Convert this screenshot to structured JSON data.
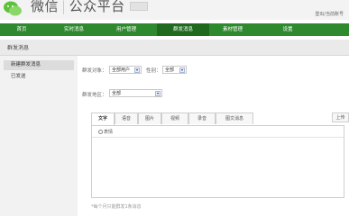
{
  "header": {
    "logo_text_a": "微信",
    "logo_text_b": "公众平台",
    "tag": "",
    "right_link": "登出/当前账号"
  },
  "nav": {
    "items": [
      "首页",
      "实时消息",
      "用户管理",
      "群发消息",
      "素材管理",
      "设置"
    ],
    "active_index": 3
  },
  "section": {
    "title": "群发消息"
  },
  "sidebar": {
    "items": [
      {
        "label": "新建群发消息",
        "active": true
      },
      {
        "label": "已发送",
        "active": false
      }
    ]
  },
  "form": {
    "target_label": "群发对象：",
    "target_value": "全部用户",
    "gender_label": "性别：",
    "gender_value": "全部",
    "region_label": "群发地区：",
    "region_value": "全部"
  },
  "tabs": {
    "items": [
      "文字",
      "语音",
      "图片",
      "视频",
      "录音",
      "图文消息"
    ],
    "active_index": 0
  },
  "upload": {
    "label": "上传"
  },
  "editor": {
    "emoji_label": "表情"
  },
  "note": "*每个月只能群发1条消息",
  "colors": {
    "nav_green": "#2f8a2f",
    "nav_active": "#206a20"
  }
}
